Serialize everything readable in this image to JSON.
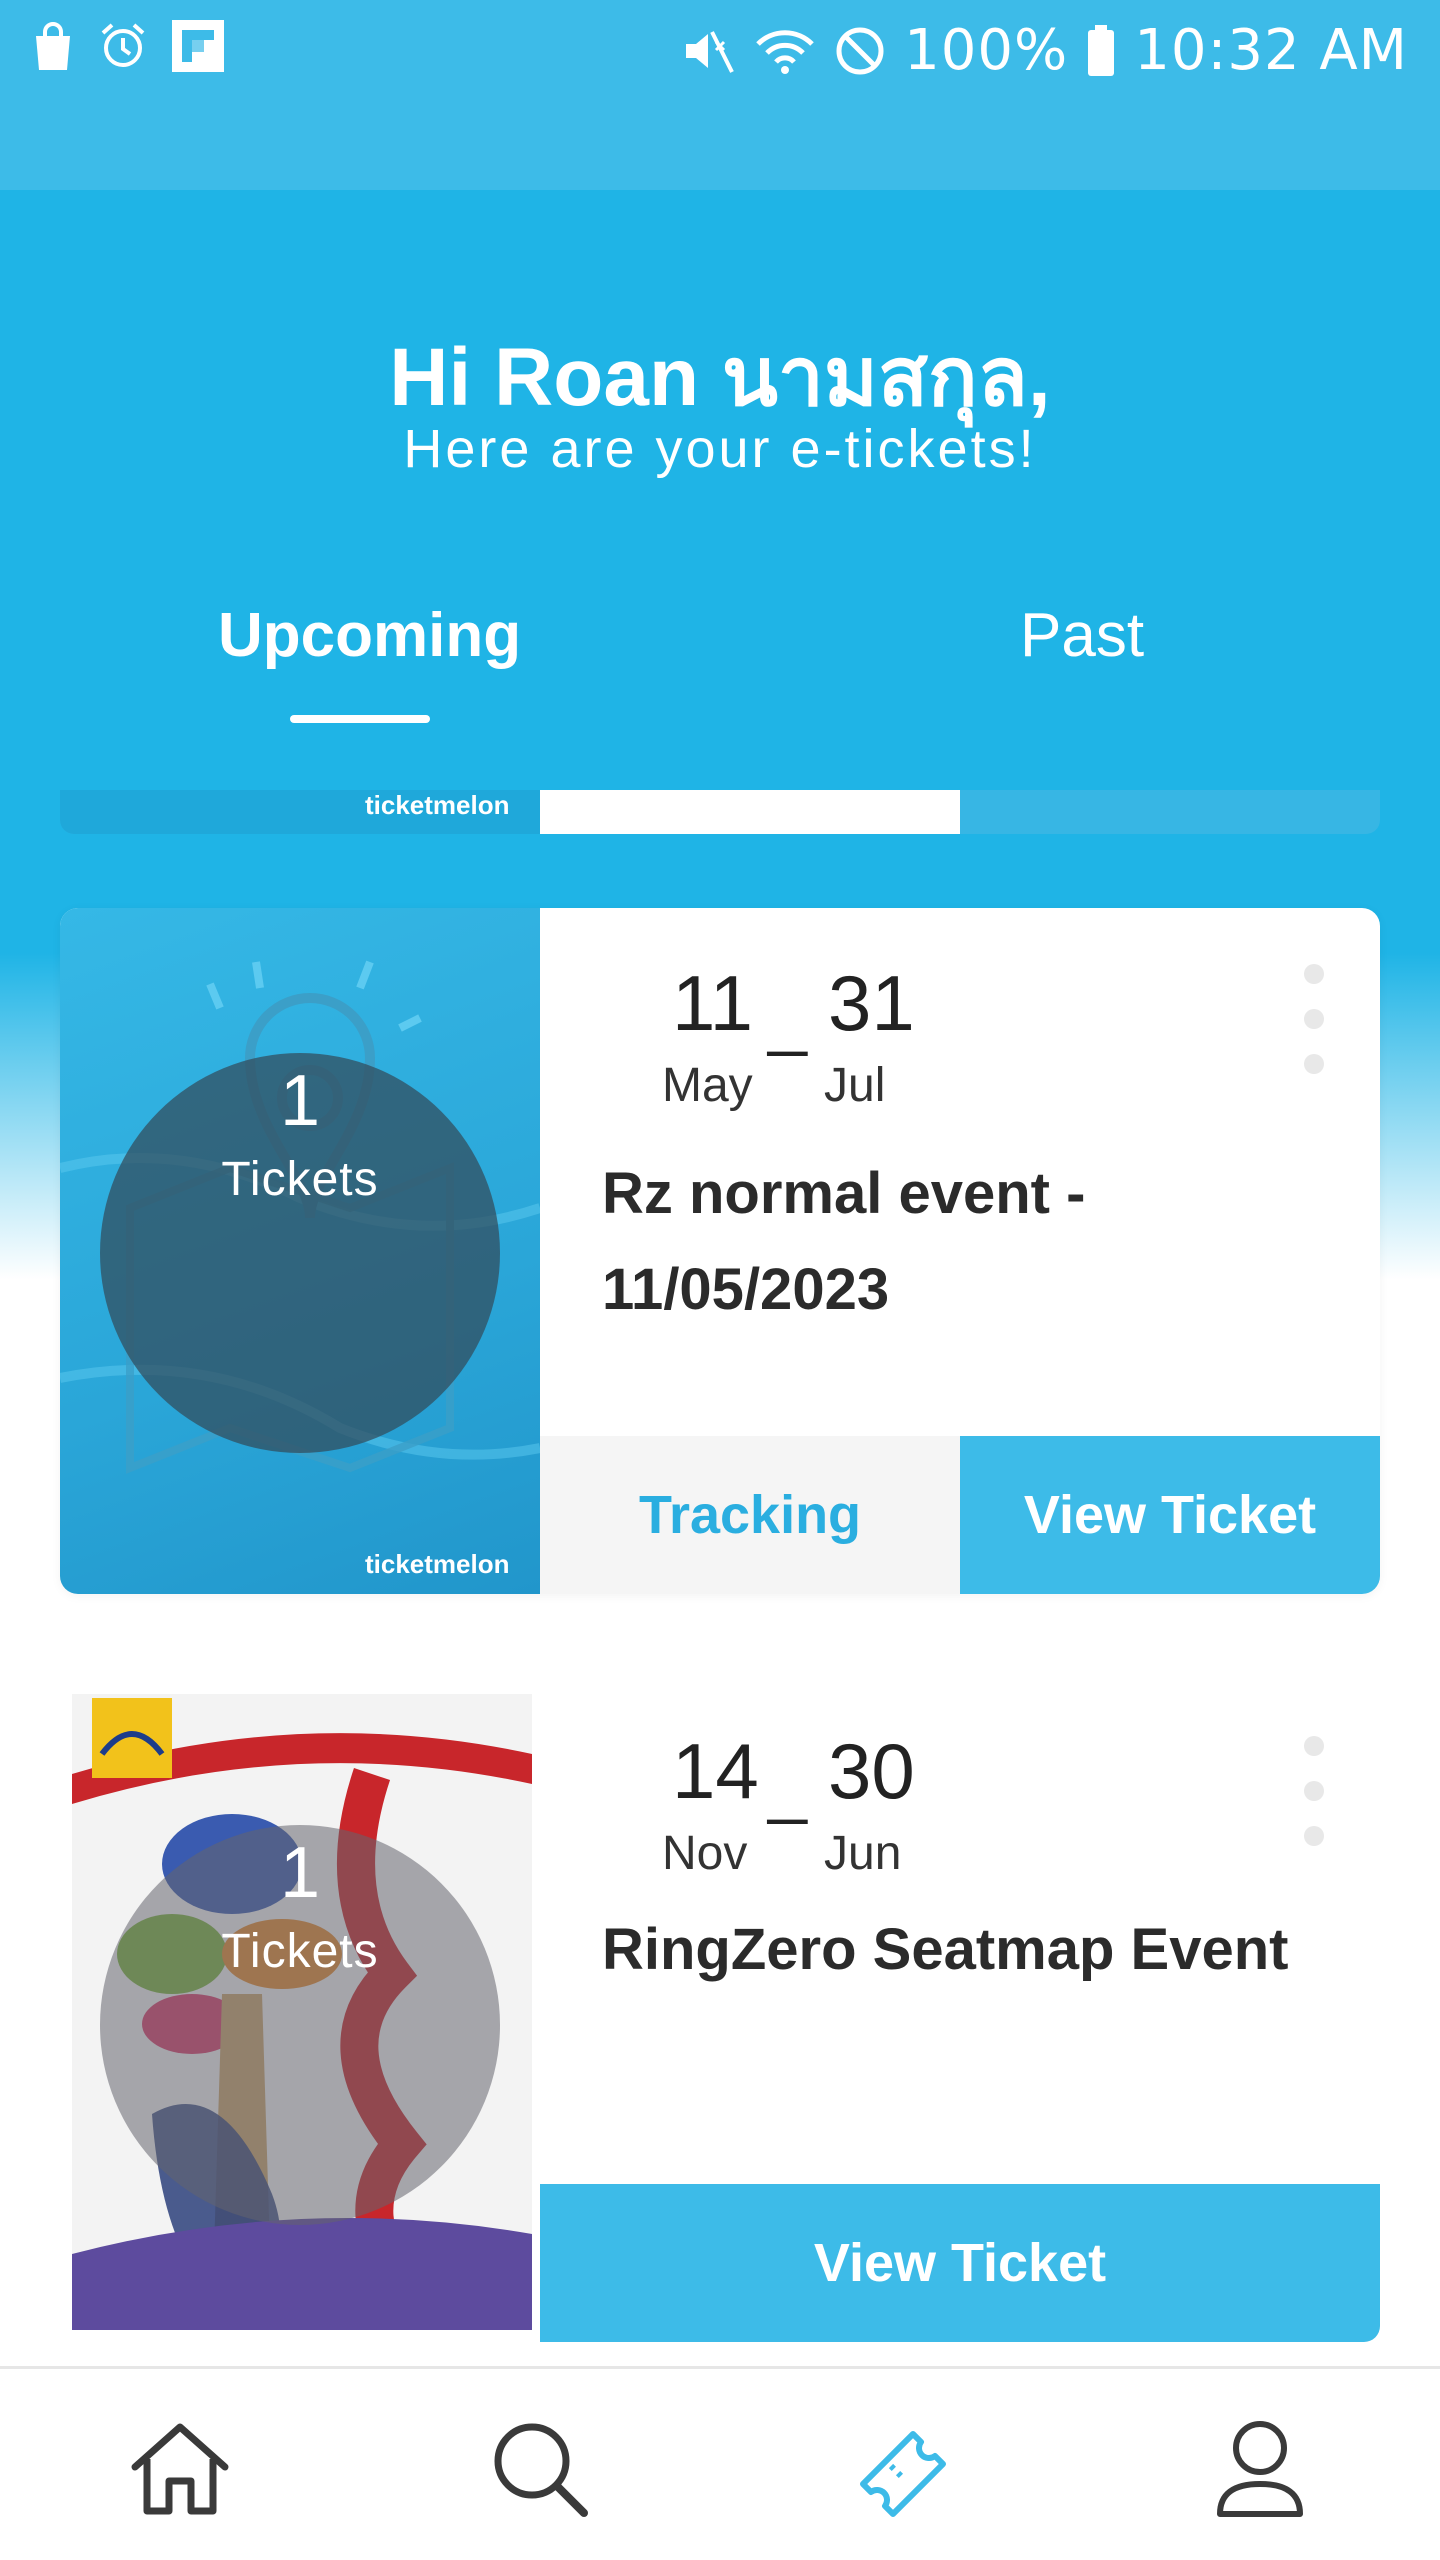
{
  "status_bar": {
    "battery": "100%",
    "time": "10:32 AM",
    "icons": [
      "shopping-bag-icon",
      "alarm-icon",
      "flipboard-icon",
      "mute-icon",
      "wifi-icon",
      "do-not-disturb-icon",
      "battery-icon"
    ]
  },
  "header": {
    "greeting": "Hi Roan นามสกุล,",
    "subtitle": "Here are your e-tickets!"
  },
  "tabs": [
    {
      "label": "Upcoming",
      "active": true
    },
    {
      "label": "Past",
      "active": false
    }
  ],
  "partial_card": {
    "brand": "ticketmelon"
  },
  "tickets": [
    {
      "count": "1",
      "count_label": "Tickets",
      "start_day": "11",
      "start_month": "May",
      "end_day": "31",
      "end_month": "Jul",
      "title": "Rz normal event - 11/05/2023",
      "brand": "ticketmelon",
      "tracking_label": "Tracking",
      "view_label": "View Ticket"
    },
    {
      "count": "1",
      "count_label": "Tickets",
      "start_day": "14",
      "start_month": "Nov",
      "end_day": "30",
      "end_month": "Jun",
      "title": "RingZero Seatmap Event",
      "view_label": "View Ticket"
    }
  ],
  "bottom_nav": [
    {
      "name": "home",
      "icon": "home-icon",
      "active": false
    },
    {
      "name": "search",
      "icon": "search-icon",
      "active": false
    },
    {
      "name": "tickets",
      "icon": "ticket-icon",
      "active": true
    },
    {
      "name": "profile",
      "icon": "profile-icon",
      "active": false
    }
  ],
  "colors": {
    "primary": "#1fb4e6",
    "button": "#3dbbe8",
    "tracking_text": "#2aaee0",
    "title_text": "#2b2b2b"
  }
}
